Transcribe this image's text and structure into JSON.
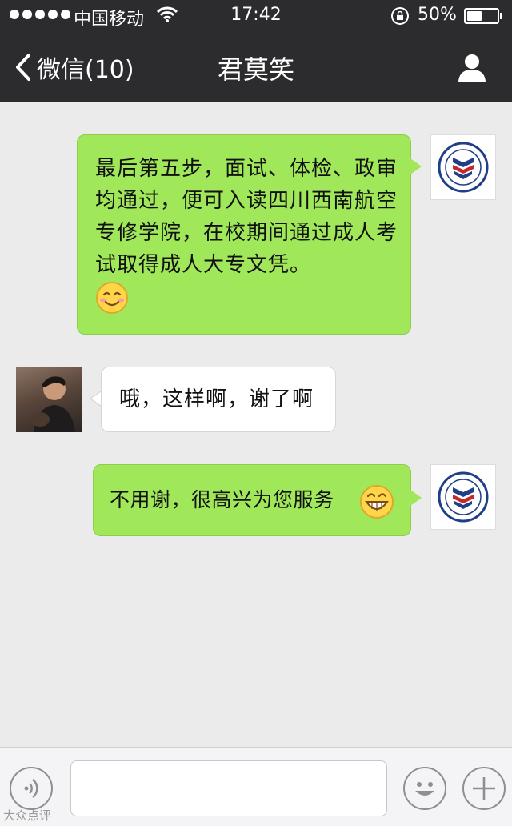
{
  "status_bar": {
    "carrier": "中国移动",
    "time": "17:42",
    "battery_percent": "50%",
    "battery_level": 0.5
  },
  "nav": {
    "back_label": "微信(10)",
    "title": "君莫笑"
  },
  "messages": [
    {
      "sender": "self",
      "text": "最后第五步，面试、体检、政审均通过，便可入读四川西南航空专修学院，在校期间通过成人考试取得成人大专文凭。",
      "emoji": "smile"
    },
    {
      "sender": "other",
      "text": "哦，这样啊，谢了啊"
    },
    {
      "sender": "self",
      "text": "不用谢，很高兴为您服务",
      "emoji": "grin"
    }
  ],
  "input_bar": {
    "placeholder": "",
    "icons": [
      "voice-icon",
      "emoji-icon",
      "plus-icon"
    ]
  },
  "watermark": "大众点评",
  "colors": {
    "header": "#2c2c2e",
    "chat_bg": "#ebebeb",
    "self_bubble": "#a0e75a",
    "other_bubble": "#ffffff"
  }
}
